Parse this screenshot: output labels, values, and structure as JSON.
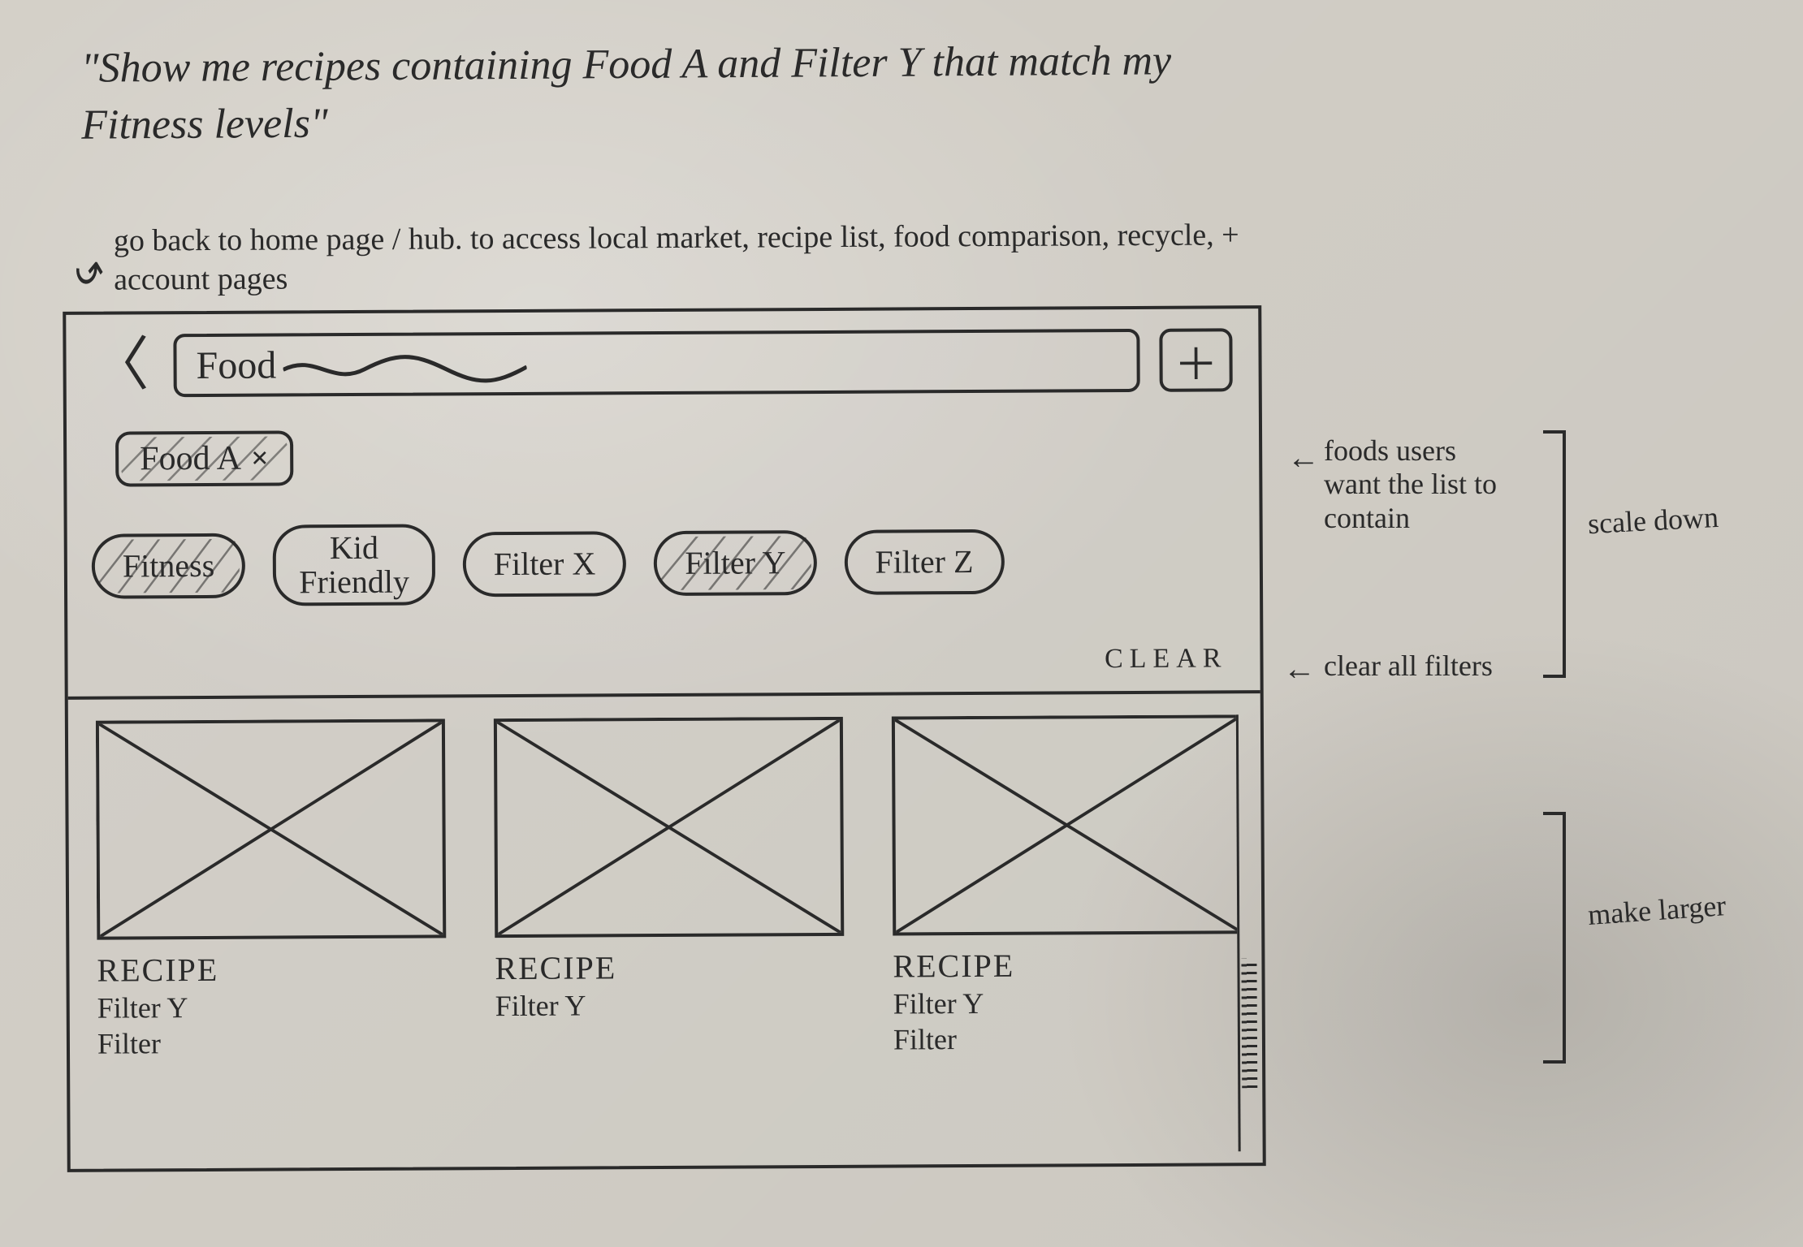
{
  "scenario_quote": "\"Show me recipes containing Food A and Filter Y that match my Fitness levels\"",
  "back_note": "go back to home page / hub. to access local market, recipe list, food comparison, recycle, + account pages",
  "search": {
    "placeholder": "Food"
  },
  "food_chip": {
    "label": "Food A",
    "remove": "×"
  },
  "filters": [
    {
      "label": "Fitness",
      "selected": true
    },
    {
      "label": "Kid\nFriendly",
      "selected": false
    },
    {
      "label": "Filter X",
      "selected": false
    },
    {
      "label": "Filter Y",
      "selected": true
    },
    {
      "label": "Filter Z",
      "selected": false
    }
  ],
  "clear_label": "CLEAR",
  "results": [
    {
      "title": "RECIPE",
      "line1": "Filter Y",
      "line2": "Filter"
    },
    {
      "title": "RECIPE",
      "line1": "Filter Y",
      "line2": ""
    },
    {
      "title": "RECIPE",
      "line1": "Filter Y",
      "line2": "Filter"
    }
  ],
  "annotations": {
    "foods_note": "foods users want the list to contain",
    "scale_down": "scale down",
    "clear_note": "clear all filters",
    "make_larger": "make larger"
  }
}
